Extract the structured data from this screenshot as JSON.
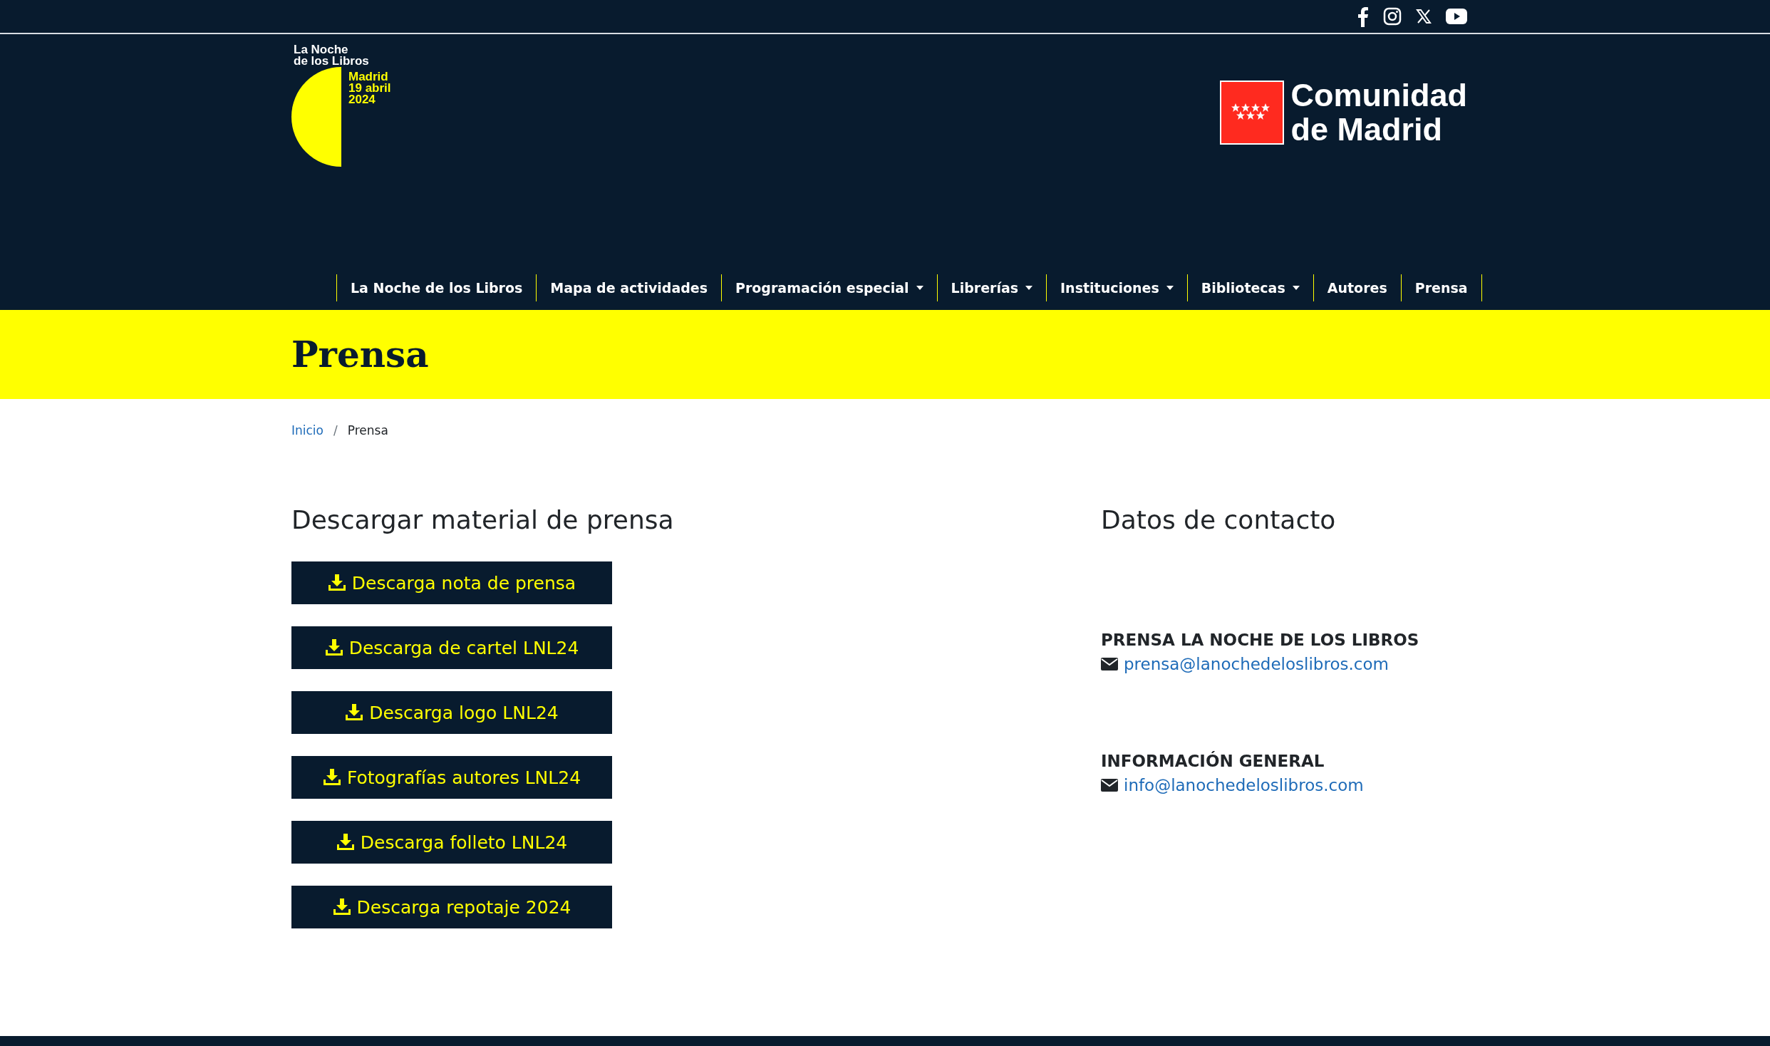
{
  "logo": {
    "title_lines": [
      "La Noche",
      "de los Libros"
    ],
    "event_lines": [
      "Madrid",
      "19 abril",
      "2024"
    ]
  },
  "sponsor": {
    "lines": [
      "Comunidad",
      "de Madrid"
    ]
  },
  "nav": [
    {
      "label": "La Noche de los Libros",
      "dropdown": false
    },
    {
      "label": "Mapa de actividades",
      "dropdown": false
    },
    {
      "label": "Programación especial",
      "dropdown": true
    },
    {
      "label": "Librerías",
      "dropdown": true
    },
    {
      "label": "Instituciones",
      "dropdown": true
    },
    {
      "label": "Bibliotecas",
      "dropdown": true
    },
    {
      "label": "Autores",
      "dropdown": false
    },
    {
      "label": "Prensa",
      "dropdown": false
    }
  ],
  "page_title": "Prensa",
  "breadcrumb_separator": "/",
  "breadcrumb": [
    {
      "label": "Inicio",
      "link": true
    },
    {
      "label": "Prensa",
      "link": false
    }
  ],
  "downloads": {
    "heading": "Descargar material de prensa",
    "buttons": [
      "Descarga nota de prensa",
      "Descarga de cartel LNL24",
      "Descarga logo LNL24",
      "Fotografías autores LNL24",
      "Descarga folleto LNL24",
      "Descarga repotaje 2024"
    ]
  },
  "contact": {
    "heading": "Datos de contacto",
    "groups": [
      {
        "title": "PRENSA LA NOCHE DE LOS LIBROS",
        "email": "prensa@lanochedeloslibros.com"
      },
      {
        "title": "INFORMACIÓN GENERAL",
        "email": "info@lanochedeloslibros.com"
      }
    ]
  }
}
